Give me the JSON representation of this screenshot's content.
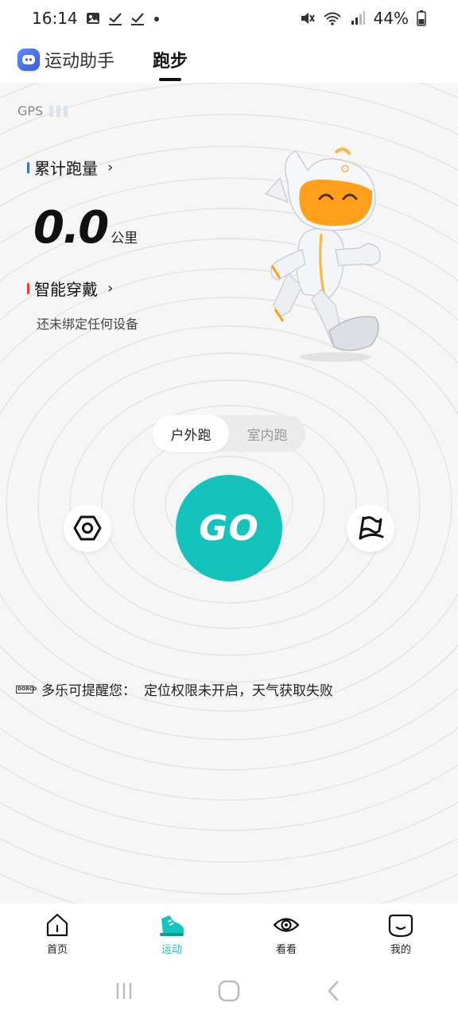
{
  "status_bar": {
    "time": "16:14",
    "battery": "44%",
    "left_icons": [
      "gallery-icon",
      "check-icon",
      "check-icon",
      "dot-icon"
    ],
    "right_icons": [
      "mute-icon",
      "wifi-icon",
      "signal-icon",
      "battery-icon"
    ]
  },
  "header": {
    "assistant_label": "运动助手",
    "active_tab": "跑步"
  },
  "gps": {
    "label": "GPS"
  },
  "stats": {
    "title": "累计跑量",
    "value": "0.0",
    "unit": "公里"
  },
  "wearable": {
    "title": "智能穿戴",
    "status": "还未绑定任何设备"
  },
  "mode_switch": {
    "outdoor": "户外跑",
    "indoor": "室内跑",
    "selected": "户外跑"
  },
  "controls": {
    "go_label": "GO",
    "settings_icon": "settings-icon",
    "route_icon": "route-flag-icon"
  },
  "reminder": {
    "prefix": "多乐可提醒您：",
    "message": "定位权限未开启，天气获取失败"
  },
  "bottom_nav": {
    "items": [
      {
        "label": "首页",
        "icon": "home-icon"
      },
      {
        "label": "运动",
        "icon": "sneaker-icon"
      },
      {
        "label": "看看",
        "icon": "eye-icon"
      },
      {
        "label": "我的",
        "icon": "smile-icon"
      }
    ],
    "active": "运动"
  },
  "colors": {
    "accent": "#15c3bd",
    "stats_mark": "#2b6fff",
    "wearable_mark": "#ff3b30",
    "mascot_orange": "#ff9f1c"
  }
}
